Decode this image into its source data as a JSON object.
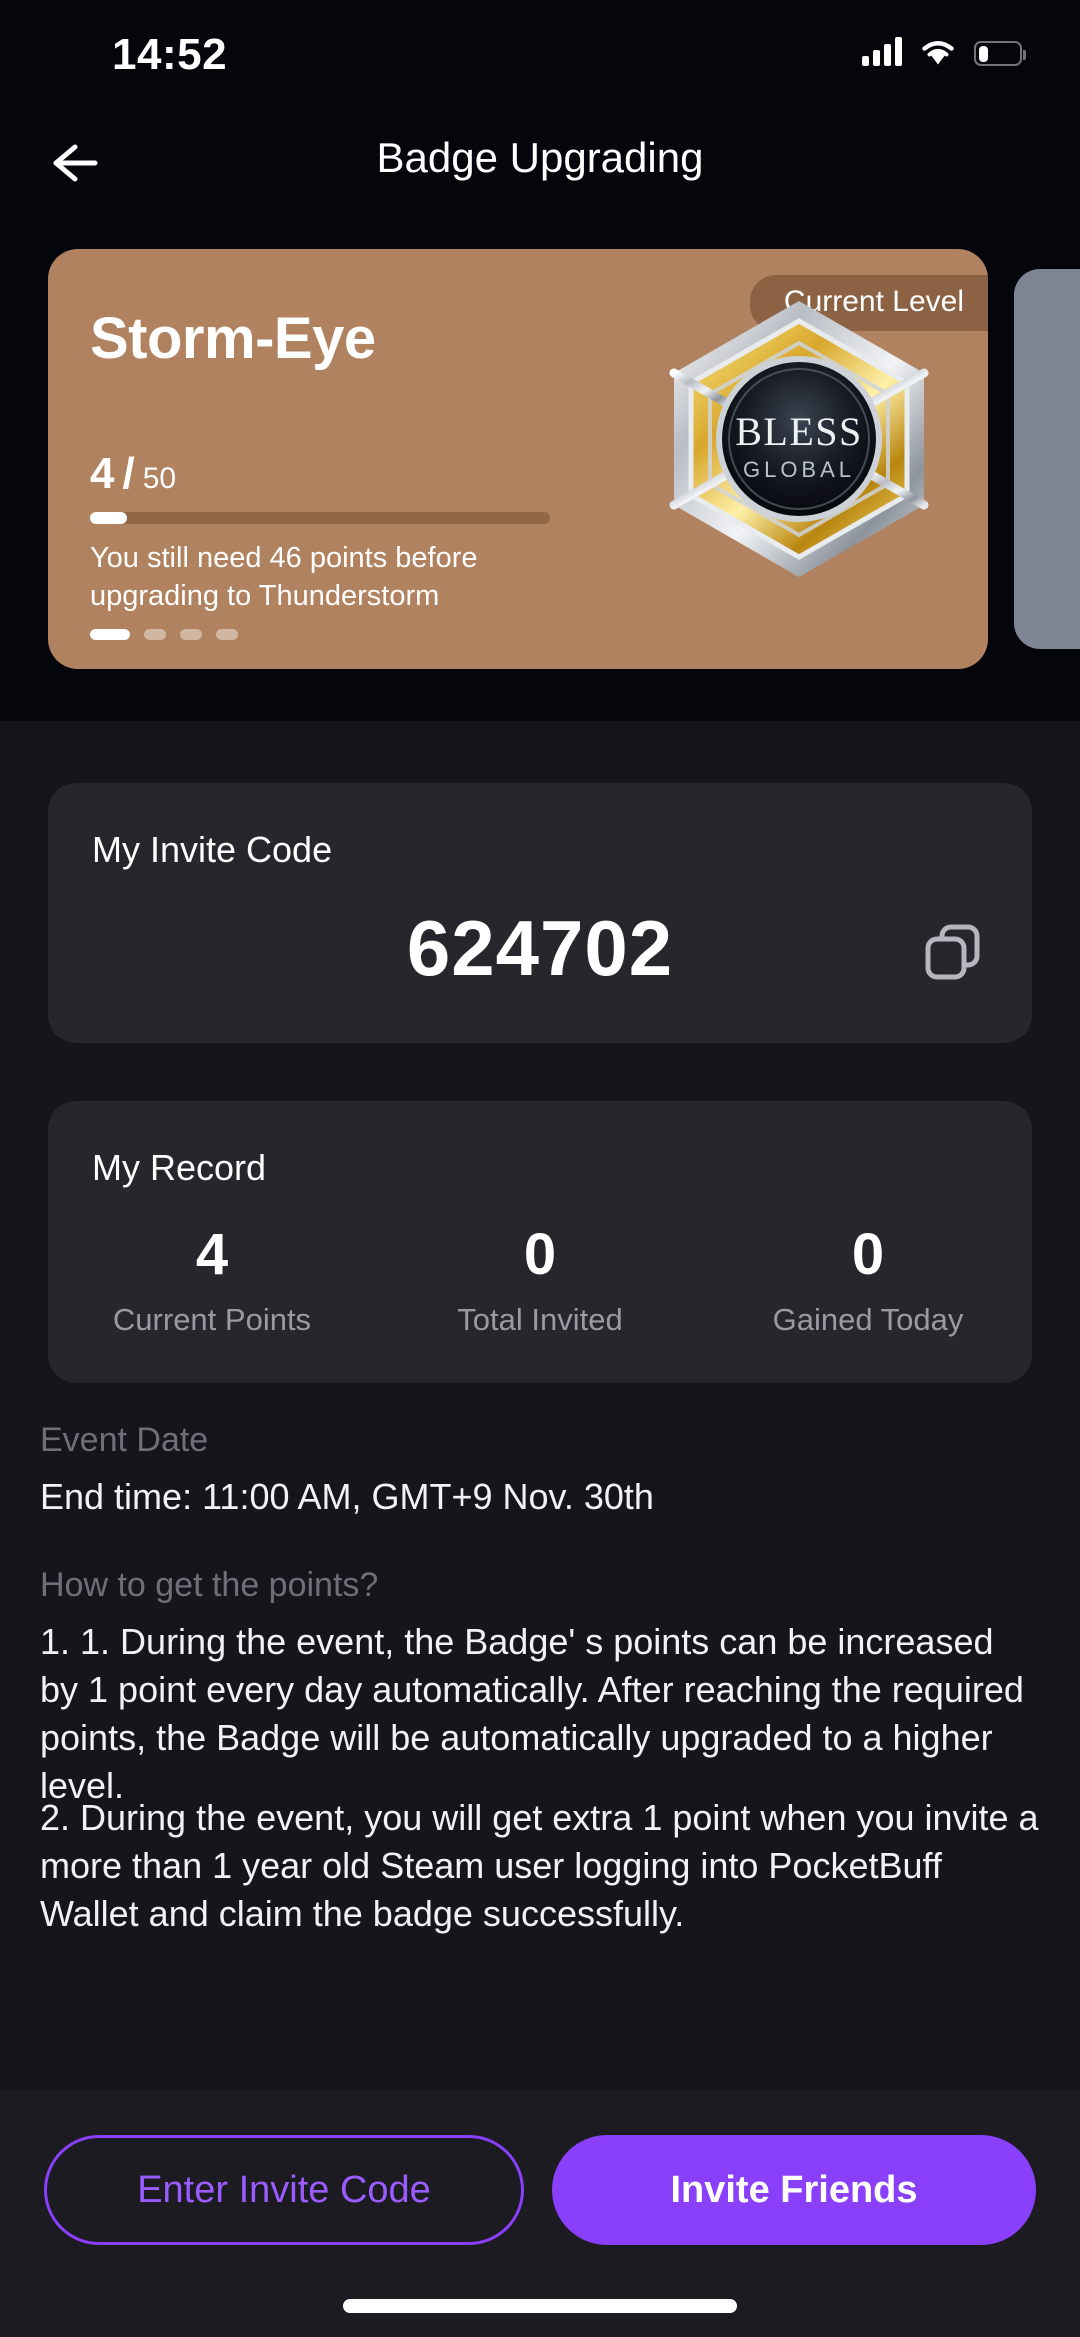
{
  "status_bar": {
    "time": "14:52",
    "icons": [
      "cellular-signal-icon",
      "wifi-icon",
      "battery-low-icon"
    ]
  },
  "header": {
    "back_icon": "arrow-left-icon",
    "title": "Badge Upgrading"
  },
  "hero": {
    "badge_name": "Storm-Eye",
    "level_pill": "Current Level",
    "emblem_text_top": "BLESS",
    "emblem_text_bottom": "GLOBAL",
    "progress_current": "4",
    "progress_separator": "/",
    "progress_max": "50",
    "progress_percent": 8,
    "hint": "You still need 46 points before upgrading to Thunderstorm",
    "dots_total": 4,
    "dots_active_index": 0,
    "card_color": "#b0825f",
    "peek_card_color": "#7d8492"
  },
  "invite_card": {
    "title": "My Invite Code",
    "code": "624702",
    "copy_icon": "copy-icon"
  },
  "record_card": {
    "title": "My Record",
    "stats": [
      {
        "value": "4",
        "label": "Current Points"
      },
      {
        "value": "0",
        "label": "Total Invited"
      },
      {
        "value": "0",
        "label": "Gained Today"
      }
    ]
  },
  "event": {
    "label": "Event Date",
    "value": "End time: 11:00 AM, GMT+9 Nov. 30th"
  },
  "how_to": {
    "label": "How to get the points?",
    "item_1": "1. 1. During the event, the Badge' s points can be increased by 1 point every day automatically. After reaching the required points, the Badge will be automatically upgraded to a higher level.",
    "item_2": "2. During the event, you will get extra 1 point when you invite a more than 1 year old Steam user logging into PocketBuff Wallet and claim the badge successfully."
  },
  "footer": {
    "enter_invite_code": "Enter Invite Code",
    "invite_friends": "Invite Friends",
    "accent_color": "#8a3ffb"
  }
}
